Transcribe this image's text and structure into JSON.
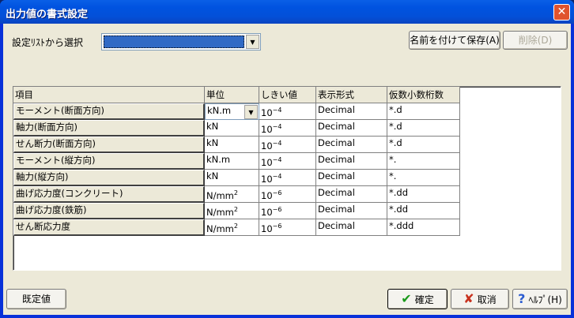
{
  "window": {
    "title": "出力値の書式設定"
  },
  "top": {
    "select_label": "設定ﾘｽﾄから選択",
    "save_as": "名前を付けて保存(A)",
    "delete": "削除(D)"
  },
  "grid": {
    "headers": [
      "項目",
      "単位",
      "しきい値",
      "表示形式",
      "仮数小数桁数"
    ],
    "rows": [
      {
        "item": "モーメント(断面方向)",
        "unit": "kN.m",
        "unit_sup": "",
        "base": "10",
        "exp": "−4",
        "format": "Decimal",
        "digits": "*.d"
      },
      {
        "item": "軸力(断面方向)",
        "unit": "kN",
        "unit_sup": "",
        "base": "10",
        "exp": "−4",
        "format": "Decimal",
        "digits": "*.d"
      },
      {
        "item": "せん断力(断面方向)",
        "unit": "kN",
        "unit_sup": "",
        "base": "10",
        "exp": "−4",
        "format": "Decimal",
        "digits": "*.d"
      },
      {
        "item": "モーメント(縦方向)",
        "unit": "kN.m",
        "unit_sup": "",
        "base": "10",
        "exp": "−4",
        "format": "Decimal",
        "digits": "*."
      },
      {
        "item": "軸力(縦方向)",
        "unit": "kN",
        "unit_sup": "",
        "base": "10",
        "exp": "−4",
        "format": "Decimal",
        "digits": "*."
      },
      {
        "item": "曲げ応力度(コンクリート)",
        "unit": "N/mm",
        "unit_sup": "2",
        "base": "10",
        "exp": "−6",
        "format": "Decimal",
        "digits": "*.dd"
      },
      {
        "item": "曲げ応力度(鉄筋)",
        "unit": "N/mm",
        "unit_sup": "2",
        "base": "10",
        "exp": "−6",
        "format": "Decimal",
        "digits": "*.dd"
      },
      {
        "item": "せん断応力度",
        "unit": "N/mm",
        "unit_sup": "2",
        "base": "10",
        "exp": "−6",
        "format": "Decimal",
        "digits": "*.ddd"
      }
    ]
  },
  "bottom": {
    "default": "既定値",
    "ok": "確定",
    "cancel": "取消",
    "help": "ﾍﾙﾌﾟ(H)"
  }
}
